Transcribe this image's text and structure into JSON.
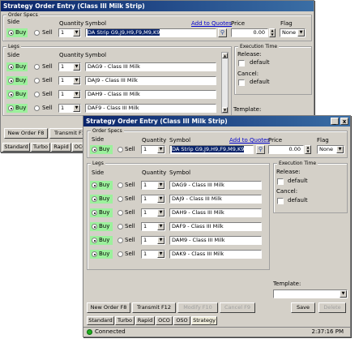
{
  "window_title": "Strategy Order Entry (Class III Milk Strip)",
  "title_buttons": [
    "_",
    "x"
  ],
  "order_specs": {
    "group_title": "Order Specs",
    "side_label": "Side",
    "quantity_label": "Quantity",
    "symbol_label": "Symbol",
    "add_to_quotes": "Add to Quotes",
    "price_label": "Price",
    "flag_label": "Flag",
    "buy": "Buy",
    "sell": "Sell",
    "quantity": "1",
    "symbol": "DA Strip G9,J9,H9,F9,M9,K9",
    "price": "0.00",
    "flag": "None",
    "quote_icon": "magnifier-icon"
  },
  "legs": {
    "group_title": "Legs",
    "side_label": "Side",
    "quantity_label": "Quantity",
    "symbol_label": "Symbol",
    "buy": "Buy",
    "sell": "Sell",
    "rows": [
      {
        "quantity": "1",
        "symbol": "DAG9 - Class III Milk"
      },
      {
        "quantity": "1",
        "symbol": "DAJ9 - Class III Milk"
      },
      {
        "quantity": "1",
        "symbol": "DAH9 - Class III Milk"
      },
      {
        "quantity": "1",
        "symbol": "DAF9 - Class III Milk"
      },
      {
        "quantity": "1",
        "symbol": "DAM9 - Class III Milk"
      },
      {
        "quantity": "1",
        "symbol": "DAK9 - Class III Milk"
      }
    ]
  },
  "execution_time": {
    "group_title": "Execution Time",
    "release_label": "Release:",
    "release_default": "default",
    "cancel_label": "Cancel:",
    "cancel_default": "default"
  },
  "template_label": "Template:",
  "buttons": {
    "new_order": "New Order F8",
    "transmit": "Transmit F12",
    "modify": "Modify F10",
    "cancel": "Cancel F9",
    "save": "Save",
    "delete": "Delete"
  },
  "back_buttons": {
    "new_order": "New Order F8",
    "transmit": "Transmit F12"
  },
  "tabs": [
    "Standard",
    "Turbo",
    "Rapid",
    "OCO",
    "OSO",
    "Strategy"
  ],
  "back_tabs": [
    "Standard",
    "Turbo",
    "Rapid",
    "OCO"
  ],
  "status": {
    "connection": "Connected",
    "time": "2:37:16 PM"
  },
  "colors": {
    "title_start": "#0a246a",
    "title_end": "#3a6ea5",
    "buy_highlight": "#9cf09c",
    "connected": "#20b020"
  }
}
